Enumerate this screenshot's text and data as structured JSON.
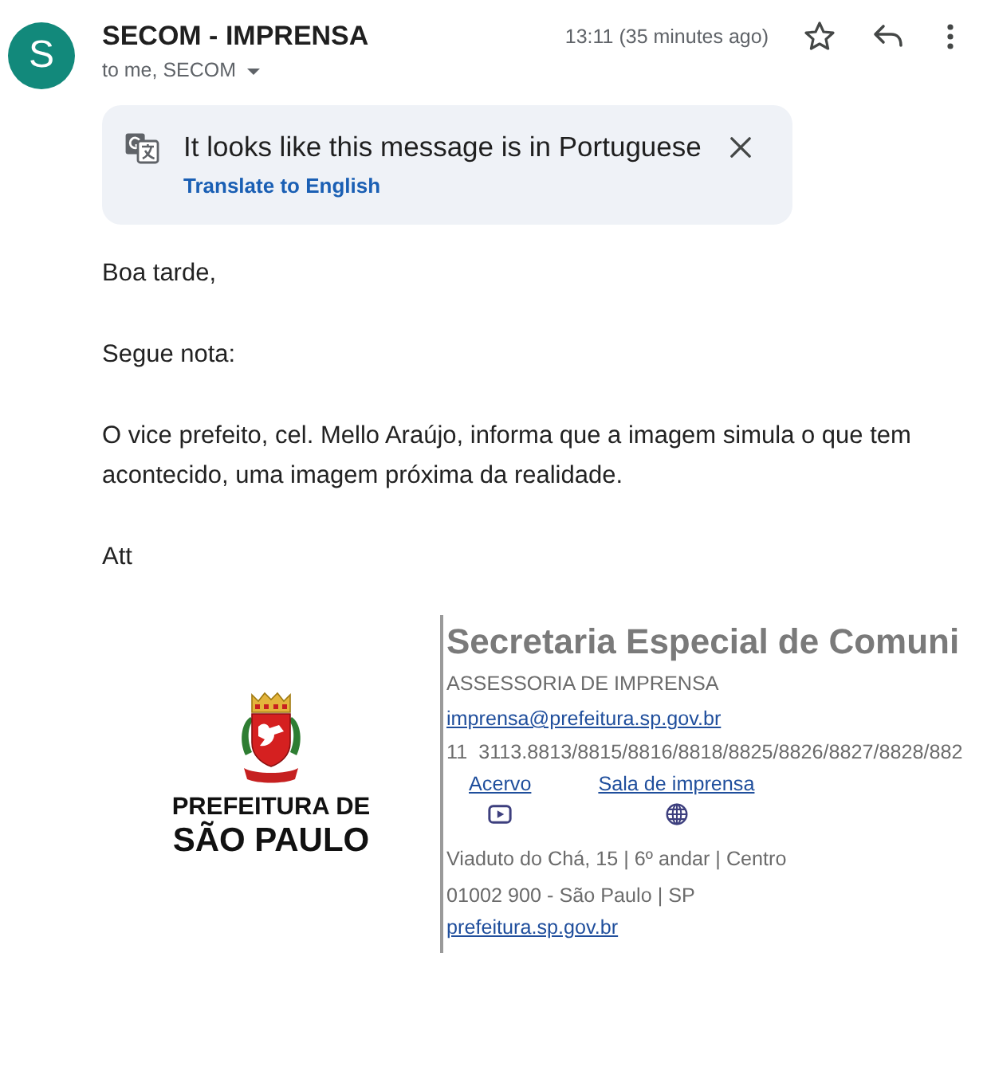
{
  "message": {
    "avatar_letter": "S",
    "sender": "SECOM - IMPRENSA",
    "recipients": "to me, SECOM",
    "time": "13:11 (35 minutes ago)",
    "starred": false
  },
  "translate_banner": {
    "text": "It looks like this message is in Portuguese",
    "action": "Translate to English"
  },
  "body": [
    "Boa tarde,",
    "Segue nota:",
    "O vice prefeito, cel. Mello Araújo, informa que a imagem simula o que tem acontecido, uma imagem próxima da realidade.",
    "Att"
  ],
  "signature": {
    "logo": {
      "line_1": "PREFEITURA DE",
      "line_2": "SÃO PAULO"
    },
    "title": "Secretaria Especial de Comuni",
    "department": "ASSESSORIA DE IMPRENSA",
    "email": "imprensa@prefeitura.sp.gov.br",
    "phone": "11  3113.8813/8815/8816/8818/8825/8826/8827/8828/882",
    "links": [
      {
        "label": "Acervo",
        "kind": "video"
      },
      {
        "label": "Sala de imprensa",
        "kind": "globe"
      }
    ],
    "address": [
      "Viaduto do Chá, 15 | 6º andar | Centro",
      "01002 900 - São Paulo | SP"
    ],
    "website": "prefeitura.sp.gov.br"
  }
}
